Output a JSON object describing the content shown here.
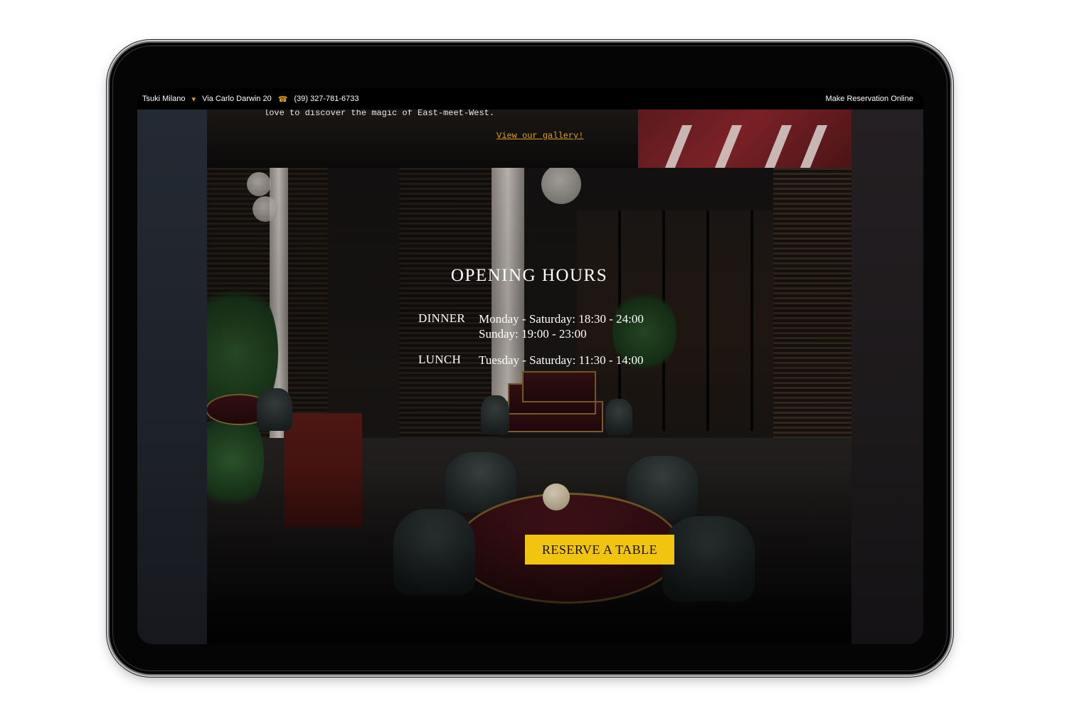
{
  "topbar": {
    "brand": "Tsuki Milano",
    "address": "Via Carlo Darwin 20",
    "phone": "(39) 327-781-6733",
    "reserve_online": "Make Reservation Online",
    "location_icon": "map-pin-icon",
    "phone_icon": "phone-icon"
  },
  "intro": {
    "text": "love to discover the magic of East-meet-West.",
    "gallery_link": "View our gallery!"
  },
  "hours": {
    "title": "OPENING HOURS",
    "rows": [
      {
        "meal": "DINNER",
        "lines": [
          "Monday - Saturday:  18:30 - 24:00",
          "Sunday: 19:00 - 23:00"
        ]
      },
      {
        "meal": "LUNCH",
        "lines": [
          "Tuesday - Saturday: 11:30 - 14:00"
        ]
      }
    ]
  },
  "cta": {
    "label": "RESERVE A TABLE"
  },
  "colors": {
    "accent": "#f1c40f",
    "link": "#e0a417",
    "background": "#0a0a0b"
  }
}
